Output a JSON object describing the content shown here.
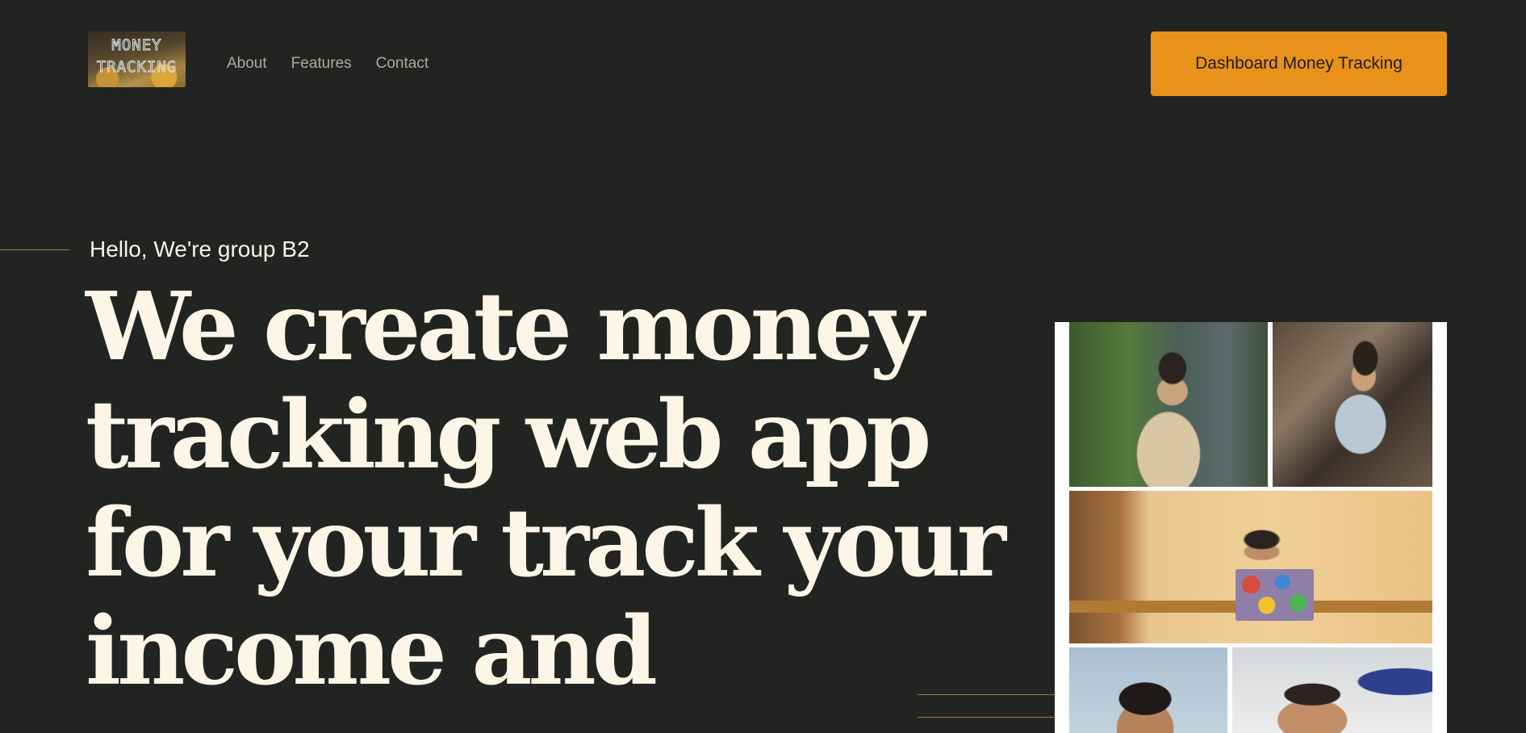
{
  "header": {
    "logo": {
      "text_line1": "MONEY",
      "text_line2": "TRACKING"
    },
    "nav": [
      {
        "label": "About"
      },
      {
        "label": "Features"
      },
      {
        "label": "Contact"
      }
    ],
    "cta_label": "Dashboard Money Tracking"
  },
  "hero": {
    "greeting": "Hello, We're group B2",
    "title_line1": "We create money",
    "title_line2": "tracking web app",
    "title_line3": "for your track your",
    "title_line4": "income and"
  },
  "colors": {
    "background": "#222421",
    "accent": "#e8911b",
    "nav_text": "#a7ad9f",
    "hero_text": "#fdf6e6"
  }
}
